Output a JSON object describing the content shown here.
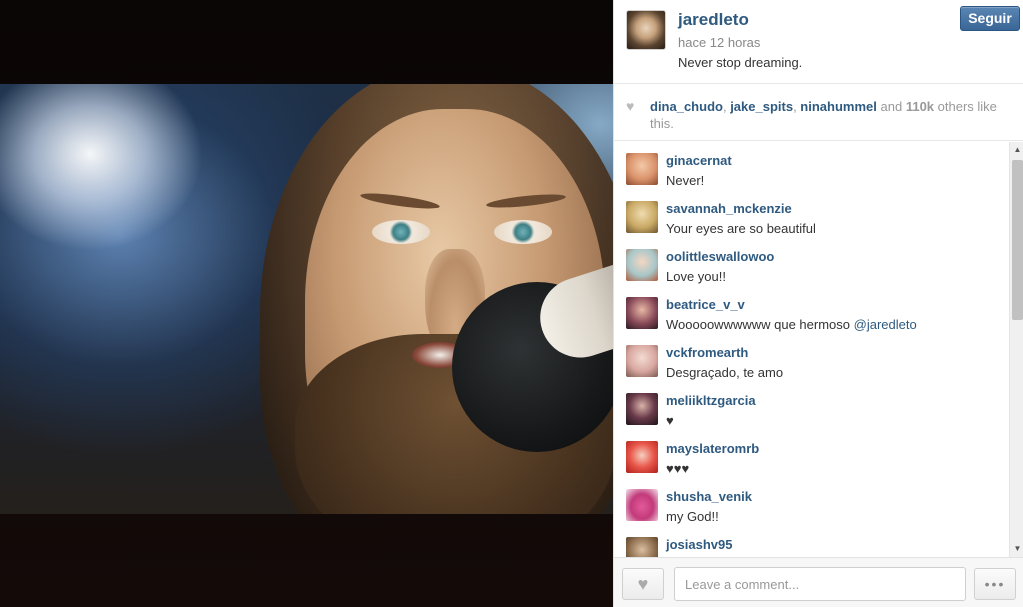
{
  "post": {
    "owner": "jaredleto",
    "time": "hace 12 horas",
    "caption": "Never stop dreaming.",
    "follow_label": "Seguir"
  },
  "likes": {
    "users": [
      "dina_chudo",
      "jake_spits",
      "ninahummel"
    ],
    "and": "and",
    "count": "110k",
    "suffix": "others like this."
  },
  "comments": [
    {
      "user": "ginacernat",
      "text": "Never!",
      "avatar_color": "#d9926a"
    },
    {
      "user": "savannah_mckenzie",
      "text": "Your eyes are so beautiful",
      "avatar_color": "#c9a964"
    },
    {
      "user": "oolittleswallowoo",
      "text": "Love you!!",
      "avatar_color": "#a7c7c9"
    },
    {
      "user": "beatrice_v_v",
      "text_prefix": "Wooooowwwwww que hermoso ",
      "mention": "@jaredleto",
      "avatar_color": "#5a2f3c"
    },
    {
      "user": "vckfromearth",
      "text": "Desgraçado, te amo",
      "avatar_color": "#d8a7a0"
    },
    {
      "user": "meliikltzgarcia",
      "text": "♥",
      "avatar_color": "#3a2430"
    },
    {
      "user": "mayslateromrb",
      "text": "♥♥♥",
      "avatar_color": "#d9322c"
    },
    {
      "user": "shusha_venik",
      "text": "my God!!",
      "avatar_color": "#c23a7a"
    },
    {
      "user": "josiashv95",
      "text": "",
      "avatar_color": "#8a6a4a"
    }
  ],
  "comment_box": {
    "placeholder": "Leave a comment...",
    "more_label": "•••"
  }
}
